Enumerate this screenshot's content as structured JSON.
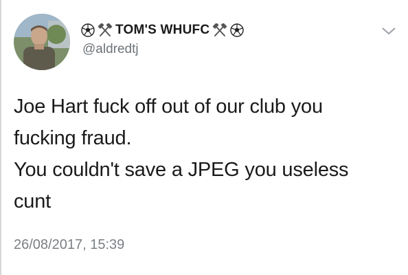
{
  "tweet": {
    "display_name": "TOM'S WHUFC",
    "handle": "@aldredtj",
    "body_lines": [
      "Joe Hart fuck off out of our club you",
      "fucking fraud.",
      "You couldn't save a JPEG you useless",
      "cunt"
    ],
    "timestamp": "26/08/2017, 15:39"
  },
  "icons": {
    "name_prefix": [
      "soccer-ball-icon",
      "crossed-hammers-icon"
    ],
    "name_suffix": [
      "crossed-hammers-icon",
      "soccer-ball-icon"
    ],
    "menu": "chevron-down-icon"
  },
  "colors": {
    "text": "#1a1a1a",
    "secondary_text": "#6e7378",
    "hammers": "#555555"
  }
}
